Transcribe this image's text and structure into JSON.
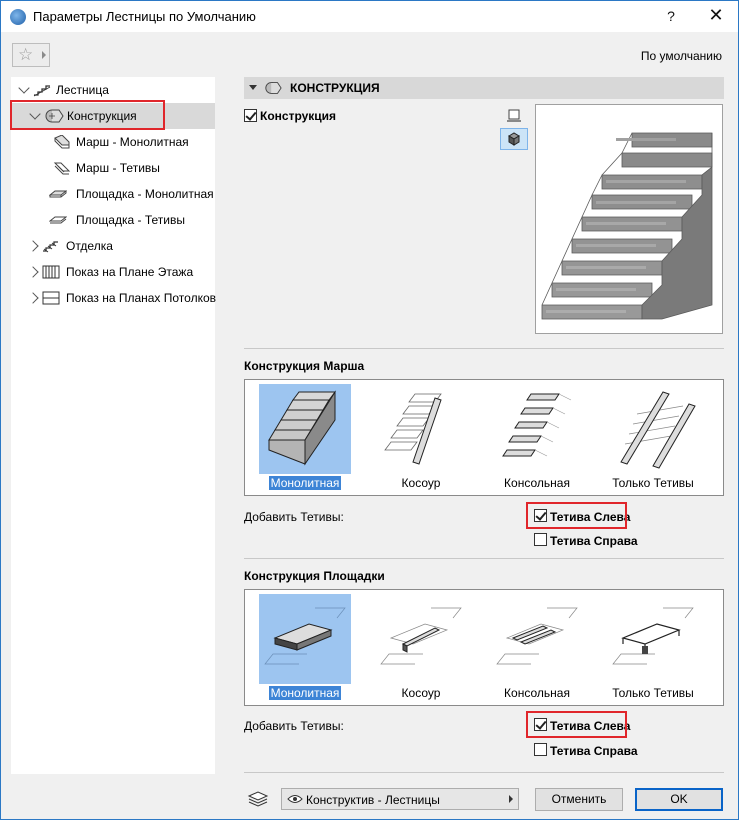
{
  "window": {
    "title": "Параметры Лестницы по Умолчанию",
    "help": "?",
    "close": "✕"
  },
  "toolbar": {
    "favorites_icon": "star-icon",
    "default_label": "По умолчанию"
  },
  "tree": {
    "items": [
      {
        "label": "Лестница",
        "icon": "stair-icon",
        "expander": "down"
      },
      {
        "label": "Конструкция",
        "icon": "structure-icon",
        "expander": "down",
        "selected": true
      },
      {
        "label": "Марш - Монолитная",
        "icon": "flight-monolithic-icon"
      },
      {
        "label": "Марш - Тетивы",
        "icon": "flight-stringers-icon"
      },
      {
        "label": "Площадка - Монолитная",
        "icon": "landing-monolithic-icon"
      },
      {
        "label": "Площадка - Тетивы",
        "icon": "landing-stringers-icon"
      },
      {
        "label": "Отделка",
        "icon": "finish-icon",
        "expander": "right"
      },
      {
        "label": "Показ на Плане Этажа",
        "icon": "floor-plan-icon",
        "expander": "right"
      },
      {
        "label": "Показ на Планах Потолков",
        "icon": "ceiling-plan-icon",
        "expander": "right"
      }
    ]
  },
  "panel": {
    "header": "КОНСТРУКЦИЯ",
    "structure_checkbox": {
      "label": "Конструкция",
      "checked": true
    },
    "view_modes": [
      "plan-view-icon",
      "3d-view-icon"
    ],
    "active_view": "3d-view-icon",
    "flight_group": {
      "title": "Конструкция Марша",
      "options": [
        "Монолитная",
        "Косоур",
        "Консольная",
        "Только Тетивы"
      ],
      "selected": "Монолитная",
      "add_stringers_label": "Добавить Тетивы:",
      "left_stringer": {
        "label": "Тетива Слева",
        "checked": true
      },
      "right_stringer": {
        "label": "Тетива Справа",
        "checked": false
      }
    },
    "landing_group": {
      "title": "Конструкция Площадки",
      "options": [
        "Монолитная",
        "Косоур",
        "Консольная",
        "Только Тетивы"
      ],
      "selected": "Монолитная",
      "add_stringers_label": "Добавить Тетивы:",
      "left_stringer": {
        "label": "Тетива Слева",
        "checked": true
      },
      "right_stringer": {
        "label": "Тетива Справа",
        "checked": false
      }
    }
  },
  "footer": {
    "layer_icon": "layers-icon",
    "layer_dropdown": "Конструктив - Лестницы",
    "cancel": "Отменить",
    "ok": "OK"
  },
  "colors": {
    "highlight_box": "#e0262b",
    "selection": "#9dc5f0",
    "caption_selection": "#3d84d6",
    "primary_border": "#0a64c8"
  }
}
